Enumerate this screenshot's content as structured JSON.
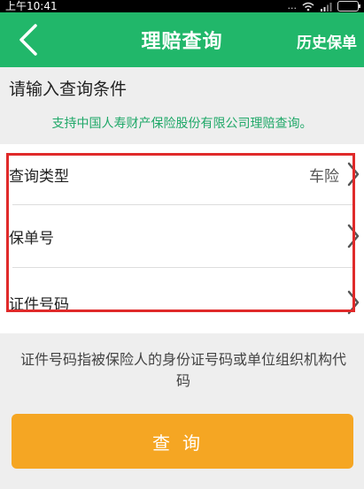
{
  "status_bar": {
    "time": "上午10:41",
    "dots": "..."
  },
  "nav": {
    "title": "理赔查询",
    "history_label": "历史保单"
  },
  "section": {
    "title": "请输入查询条件"
  },
  "notice": "支持中国人寿财产保险股份有限公司理赔查询。",
  "form": {
    "rows": [
      {
        "label": "查询类型",
        "value": "车险"
      },
      {
        "label": "保单号",
        "value": ""
      },
      {
        "label": "证件号码",
        "value": ""
      }
    ]
  },
  "hint": "证件号码指被保险人的身份证号码或单位组织机构代码",
  "query_button_label": "查询",
  "colors": {
    "nav_green": "#21b76a",
    "notice_green": "#1fa868",
    "button_orange": "#f5a623",
    "highlight_red": "#e02a2a"
  },
  "icons": [
    "back-arrow-icon",
    "chevron-right-icon",
    "wifi-icon",
    "signal-icon",
    "battery-icon"
  ]
}
